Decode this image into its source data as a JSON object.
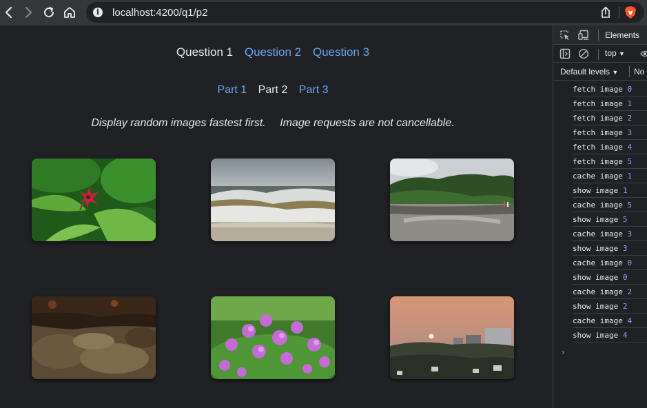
{
  "browser": {
    "url": "localhost:4200/q1/p2"
  },
  "page": {
    "questions": [
      {
        "label": "Question 1",
        "current": true
      },
      {
        "label": "Question 2",
        "current": false
      },
      {
        "label": "Question 3",
        "current": false
      }
    ],
    "parts": [
      {
        "label": "Part 1",
        "current": false
      },
      {
        "label": "Part 2",
        "current": true
      },
      {
        "label": "Part 3",
        "current": false
      }
    ],
    "description_1": "Display random images fastest first.",
    "description_2": "Image requests are not cancellable.",
    "images": [
      "red-flower",
      "beach-waves",
      "beach-trees",
      "rock-texture",
      "purple-flowers",
      "sunset-city"
    ]
  },
  "devtools": {
    "tab": "Elements",
    "context": "top",
    "levels": "Default levels",
    "no_label": "No",
    "logs": [
      {
        "text": "fetch image",
        "n": "0"
      },
      {
        "text": "fetch image",
        "n": "1"
      },
      {
        "text": "fetch image",
        "n": "2"
      },
      {
        "text": "fetch image",
        "n": "3"
      },
      {
        "text": "fetch image",
        "n": "4"
      },
      {
        "text": "fetch image",
        "n": "5"
      },
      {
        "text": "cache image",
        "n": "1"
      },
      {
        "text": "show image",
        "n": "1"
      },
      {
        "text": "cache image",
        "n": "5"
      },
      {
        "text": "show image",
        "n": "5"
      },
      {
        "text": "cache image",
        "n": "3"
      },
      {
        "text": "show image",
        "n": "3"
      },
      {
        "text": "cache image",
        "n": "0"
      },
      {
        "text": "show image",
        "n": "0"
      },
      {
        "text": "cache image",
        "n": "2"
      },
      {
        "text": "show image",
        "n": "2"
      },
      {
        "text": "cache image",
        "n": "4"
      },
      {
        "text": "show image",
        "n": "4"
      }
    ],
    "prompt": "›"
  },
  "colors": {
    "link": "#6aa5f5",
    "text": "#e8eaed",
    "background": "#202124",
    "log_number": "#9c9cff"
  }
}
